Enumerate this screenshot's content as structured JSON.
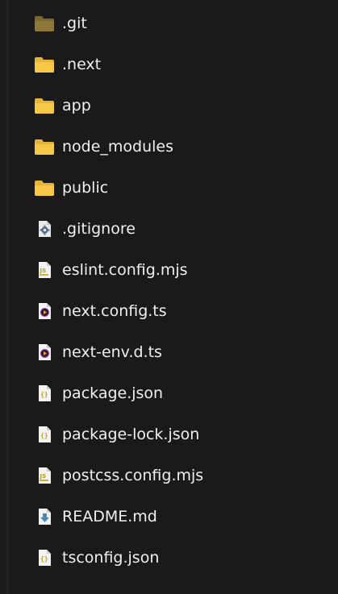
{
  "colors": {
    "background": "#1a1a1a",
    "text": "#f0f0f0",
    "folder": "#f7c847",
    "folder_git": "#7d6833"
  },
  "files": [
    {
      "name": ".git",
      "icon": "folder-git-icon"
    },
    {
      "name": ".next",
      "icon": "folder-icon"
    },
    {
      "name": "app",
      "icon": "folder-icon"
    },
    {
      "name": "node_modules",
      "icon": "folder-icon"
    },
    {
      "name": "public",
      "icon": "folder-icon"
    },
    {
      "name": ".gitignore",
      "icon": "settings-file-icon"
    },
    {
      "name": "eslint.config.mjs",
      "icon": "js-file-icon"
    },
    {
      "name": "next.config.ts",
      "icon": "media-file-icon"
    },
    {
      "name": "next-env.d.ts",
      "icon": "media-file-icon"
    },
    {
      "name": "package.json",
      "icon": "json-file-icon"
    },
    {
      "name": "package-lock.json",
      "icon": "json-file-icon"
    },
    {
      "name": "postcss.config.mjs",
      "icon": "js-file-icon"
    },
    {
      "name": "README.md",
      "icon": "markdown-file-icon"
    },
    {
      "name": "tsconfig.json",
      "icon": "json-file-icon"
    }
  ]
}
